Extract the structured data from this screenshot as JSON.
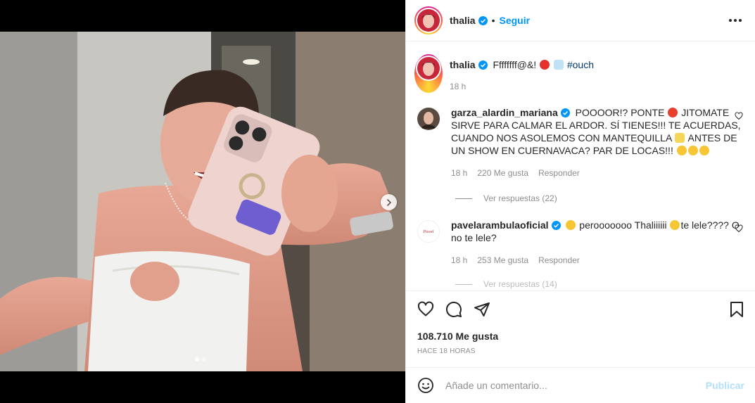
{
  "post": {
    "author": "thalia",
    "follow_label": "Seguir",
    "separator": "•",
    "caption": {
      "text": "Ffffffff@&!",
      "hashtag": "#ouch",
      "time": "18 h"
    },
    "likes": "108.710 Me gusta",
    "posted_ago": "HACE 18 HORAS",
    "carousel_total": 2,
    "carousel_index": 1
  },
  "comments": [
    {
      "username": "garza_alardin_mariana",
      "verified": true,
      "text_1": "POOOOR!? PONTE",
      "text_2": "JITOMATE SIRVE PARA CALMAR EL ARDOR. SÍ TIENES!!! TE ACUERDAS, CUANDO NOS ASOLEMOS CON MANTEQUILLA",
      "text_3": "ANTES DE UN SHOW EN CUERNAVACA? PAR DE LOCAS!!!",
      "time": "18 h",
      "likes": "220 Me gusta",
      "reply_label": "Responder",
      "view_replies": "Ver respuestas (22)"
    },
    {
      "username": "pavelarambulaoficial",
      "verified": true,
      "text_1": "perooooooo Thaliiiiii",
      "text_2": "te lele????  O no te lele?",
      "time": "18 h",
      "likes": "253 Me gusta",
      "reply_label": "Responder",
      "view_replies": "Ver respuestas (14)"
    }
  ],
  "composer": {
    "placeholder": "Añade un comentario...",
    "publish_label": "Publicar"
  },
  "colors": {
    "accent": "#0095f6",
    "hashtag": "#00376b",
    "muted": "#8e8e8e",
    "publish_disabled": "#b2dffc"
  },
  "icons": {
    "more": "more-horizontal-icon",
    "like": "heart-icon",
    "comment": "comment-icon",
    "share": "paper-plane-icon",
    "save": "bookmark-icon",
    "emoji": "smiley-icon",
    "next": "chevron-right-icon"
  }
}
